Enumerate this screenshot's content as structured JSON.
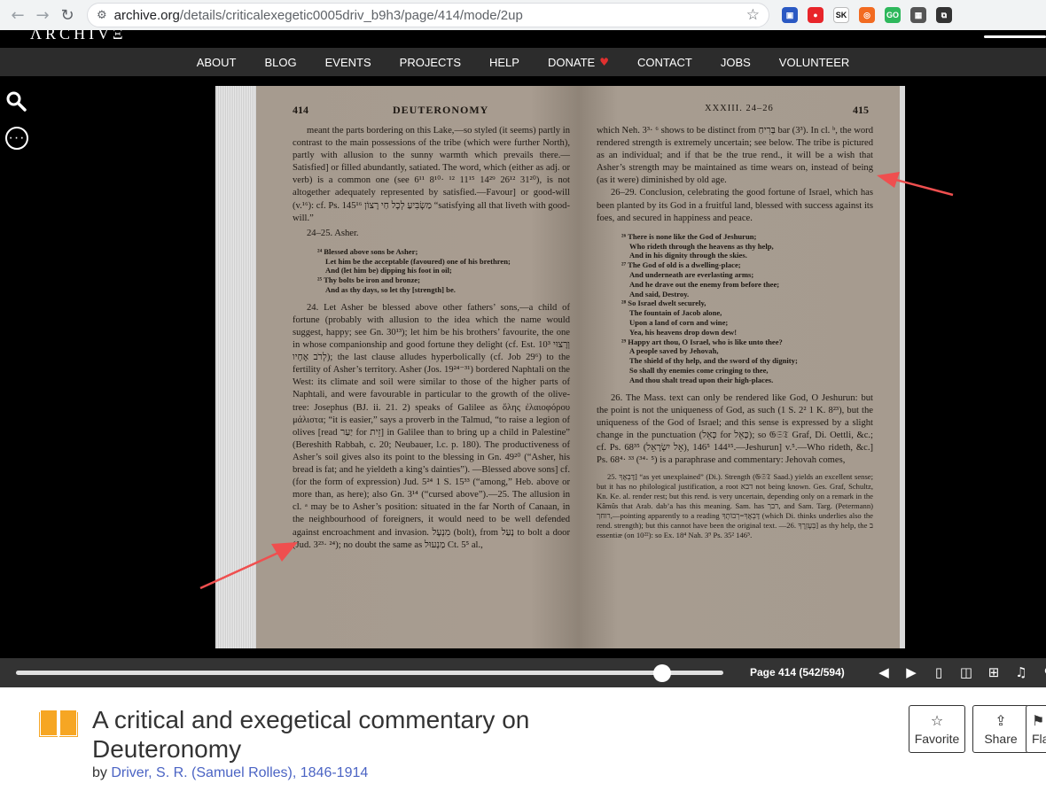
{
  "browser": {
    "url_host": "archive.org",
    "url_path": "/details/criticalexegetic0005driv_b9h3/page/414/mode/2up",
    "extensions": [
      {
        "label": "▣",
        "color": "#2b59c3"
      },
      {
        "label": "●",
        "color": "#e8252a"
      },
      {
        "label": "SK",
        "color": "#ffffff"
      },
      {
        "label": "◎",
        "color": "#f26b21"
      },
      {
        "label": "GO",
        "color": "#2eb85c"
      },
      {
        "label": "▦",
        "color": "#555555"
      },
      {
        "label": "⧉",
        "color": "#333333"
      }
    ]
  },
  "nav": {
    "items": [
      "ABOUT",
      "BLOG",
      "EVENTS",
      "PROJECTS",
      "HELP",
      "DONATE",
      "CONTACT",
      "JOBS",
      "VOLUNTEER"
    ]
  },
  "reader": {
    "left": {
      "page_number": "414",
      "running_head": "DEUTERONOMY",
      "paras": [
        "meant the parts bordering on this Lake,—so styled (it seems) partly in contrast to the main possessions of the tribe (which were further North), partly with allusion to the sunny warmth which prevails there.—Satisfied] or filled abundantly, satiated. The word, which (either as adj. or verb) is a common one (see 6¹¹ 8¹⁰· ¹² 11¹⁵ 14²⁹ 26¹² 31²⁰), is not altogether adequately represented by satisfied.—Favour] or good-will (v.¹⁶): cf. Ps. 145¹⁶ מַשְׂבִּיעַ לְכָל חַי רָצוֹן “satisfying all that liveth with good-will.”",
        "24–25. Asher.",
        "24. Let Asher be blessed above other fathers’ sons,—a child of fortune (probably with allusion to the idea which the name would suggest, happy; see Gn. 30¹³); let him be his brothers’ favourite, the one in whose companionship and good fortune they delight (cf. Est. 10³ וְרָצוּי לְרֹב אֶחָיו); the last clause alludes hyperbolically (cf. Job 29⁶) to the fertility of Asher’s territory. Asher (Jos. 19²⁴⁻³¹) bordered Naphtali on the West: its climate and soil were similar to those of the higher parts of Naphtali, and were favourable in particular to the growth of the olive-tree: Josephus (BJ. ii. 21. 2) speaks of Galilee as ὅλης ἐλαιοφόρου μάλιστα; “it is easier,” says a proverb in the Talmud, “to raise a legion of olives [read יַעַר for זֵית] in Galilee than to bring up a child in Palestine” (Bereshith Rabbah, c. 20; Neubauer, l.c. p. 180). The productiveness of Asher’s soil gives also its point to the blessing in Gn. 49²⁰ (“Asher, his bread is fat; and he yieldeth a king’s dainties”). —Blessed above sons] cf. (for the form of expression) Jud. 5²⁴ 1 S. 15³³ (“among,” Heb. above or more than, as here); also Gn. 3¹⁴ (“cursed above”).—25. The allusion in cl. ᵃ may be to Asher’s position: situated in the far North of Canaan, in the neighbourhood of foreigners, it would need to be well defended against encroachment and invasion. מִנְעָל (bolt), from נָעַל to bolt a door (Jud. 3²³· ²⁴); no doubt the same as מַנְעוּל Ct. 5⁵ al.,"
      ],
      "verse": [
        "²⁴ Blessed above sons be Asher;",
        "Let him be the acceptable (favoured) one of his brethren;",
        "And (let him be) dipping his foot in oil;",
        "²⁵ Thy bolts be iron and bronze;",
        "And as thy days, so let thy [strength] be."
      ]
    },
    "right": {
      "page_number": "415",
      "running_head": "XXXIII. 24–26",
      "paras": [
        "which Neh. 3³· ⁶ shows to be distinct from בְּרִיחַ bar (3³). In cl. ᵇ, the word rendered strength is extremely uncertain; see below. The tribe is pictured as an individual; and if that be the true rend., it will be a wish that Asher’s strength may be maintained as time wears on, instead of being (as it were) diminished by old age.",
        "26–29. Conclusion, celebrating the good fortune of Israel, which has been planted by its God in a fruitful land, blessed with success against its foes, and secured in happiness and peace.",
        "26. The Mass. text can only be rendered like God, O Jeshurun: but the point is not the uniqueness of God, as such (1 S. 2² 1 K. 8²³), but the uniqueness of the God of Israel; and this sense is expressed by a slight change in the punctuation (כְּאֵל for כָּאֵל); so 𝔊𝔖𝔗 Graf, Di. Oettli, &c.; cf. Ps. 68³⁵ (אֵל יִשְׂרָאֵל), 144¹⁵ 146⁵.—Jeshurun] v.⁵.—Who rideth, &c.] Ps. 68⁴· ³³ (³⁴· ⁵) is a paraphrase and commentary: Jehovah comes,",
        "25. דָּבְאֶךָ] “as yet unexplained” (Di.). Strength (𝔊𝔖𝔗 Saad.) yields an excellent sense; but it has no philological justification, a root דבא not being known. Ges. Graf, Schultz, Kn. Ke. al. render rest; but this rend. is very uncertain, depending only on a remark in the Kâmûs that Arab. dab’a has this meaning. Sam. has רבך, and Sam. Targ. (Petermann) רוחך,—pointing apparently to a reading דָּבְאֶךָ=רְבוֹתֶךָ (which Di. thinks underlies also the rend. strength); but this cannot have been the original text. —26. בְּעֶזְרֶךָ] as thy help, the ב essentiæ (on 10²²): so Ex. 18⁴ Nah. 3⁹ Ps. 35² 146⁵."
      ],
      "verse": [
        "²⁶ There is none like the God of Jeshurun;",
        "Who rideth through the heavens as thy help,",
        "And in his dignity through the skies.",
        "²⁷ The God of old is a dwelling-place;",
        "And underneath are everlasting arms;",
        "And he drave out the enemy from before thee;",
        "And said, Destroy.",
        "²⁸ So Israel dwelt securely,",
        "The fountain of Jacob alone,",
        "Upon a land of corn and wine;",
        "Yea, his heavens drop down dew!",
        "²⁹ Happy art thou, O Israel, who is like unto thee?",
        "A people saved by Jehovah,",
        "The shield of thy help, and the sword of thy dignity;",
        "So shall thy enemies come cringing to thee,",
        "And thou shalt tread upon their high-places."
      ]
    },
    "progress_fraction": 0.913,
    "page_label": "Page 414 (542/594)"
  },
  "item": {
    "title": "A critical and exegetical commentary on Deuteronomy",
    "by_prefix": "by",
    "author": "Driver, S. R. (Samuel Rolles), 1846-1914",
    "actions": [
      {
        "label": "Favorite",
        "icon": "☆"
      },
      {
        "label": "Share",
        "icon": "⇪"
      },
      {
        "label": "Fla",
        "icon": "⚑"
      }
    ]
  },
  "colors": {
    "page": "#a69b8f",
    "accent_arrow": "#ef4f4f",
    "author_link": "#4b64c4",
    "heart": "#e0302f"
  }
}
